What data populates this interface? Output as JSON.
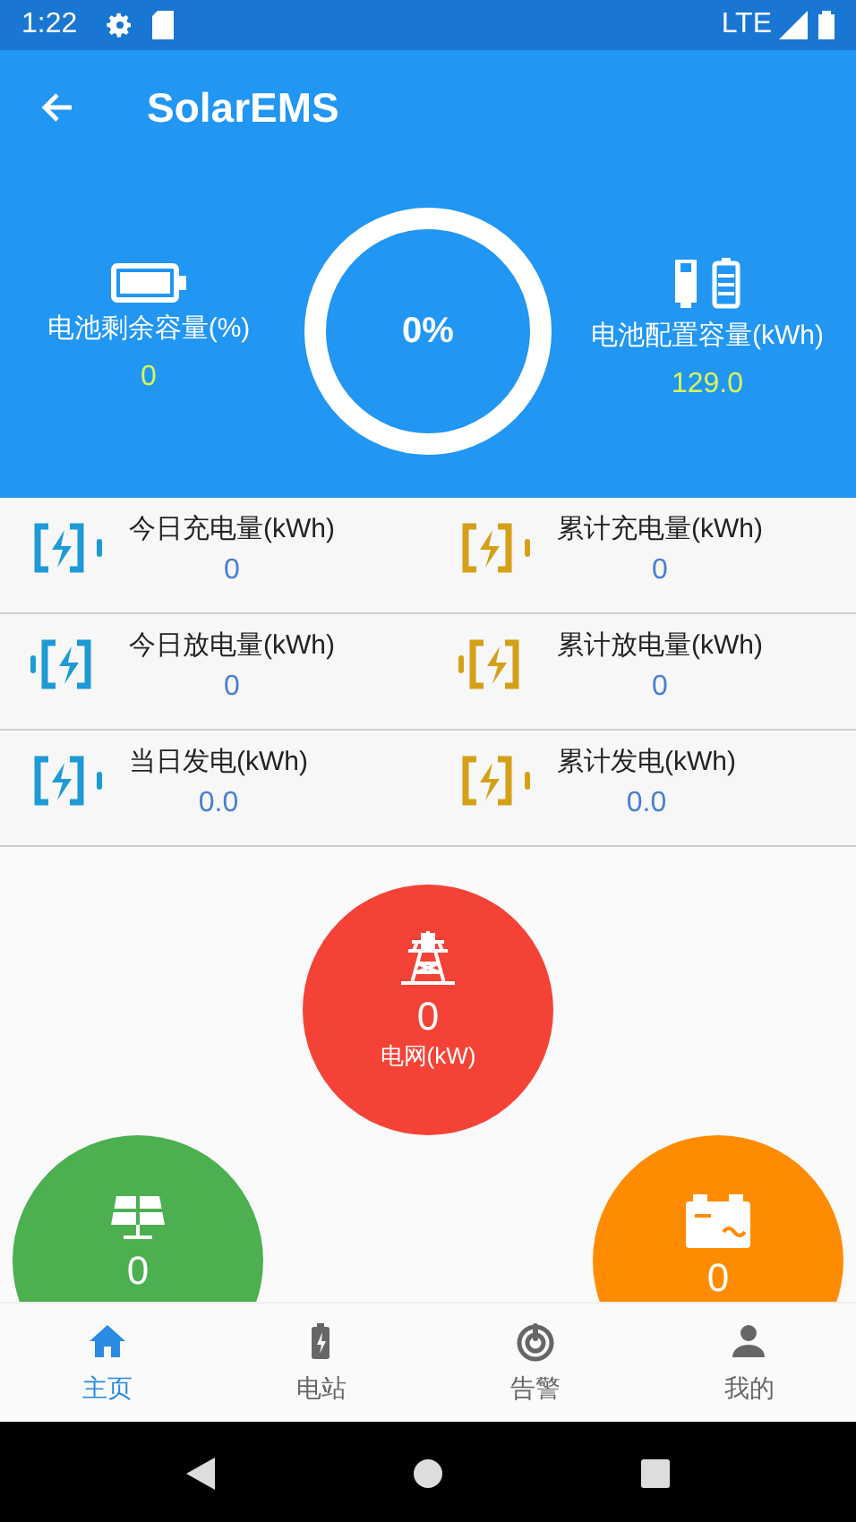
{
  "status_bar": {
    "time": "1:22",
    "network": "LTE"
  },
  "app_bar": {
    "title": "SolarEMS"
  },
  "header": {
    "left": {
      "label": "电池剩余容量(%)",
      "value": "0"
    },
    "gauge": {
      "text": "0%"
    },
    "right": {
      "label": "电池配置容量(kWh)",
      "value": "129.0"
    }
  },
  "stats": [
    {
      "label": "今日充电量(kWh)",
      "value": "0",
      "color": "#1e9ad6",
      "kind": "charge"
    },
    {
      "label": "累计充电量(kWh)",
      "value": "0",
      "color": "#d4a017",
      "kind": "charge"
    },
    {
      "label": "今日放电量(kWh)",
      "value": "0",
      "color": "#1e9ad6",
      "kind": "discharge"
    },
    {
      "label": "累计放电量(kWh)",
      "value": "0",
      "color": "#d4a017",
      "kind": "discharge"
    },
    {
      "label": "当日发电(kWh)",
      "value": "0.0",
      "color": "#1e9ad6",
      "kind": "charge"
    },
    {
      "label": "累计发电(kWh)",
      "value": "0.0",
      "color": "#d4a017",
      "kind": "charge"
    }
  ],
  "flow": [
    {
      "kind": "grid",
      "value": "0",
      "label": "电网(kW)",
      "color": "#f44336"
    },
    {
      "kind": "solar",
      "value": "0",
      "color": "#4caf50"
    },
    {
      "kind": "storage",
      "value": "0",
      "color": "#ff8c00"
    }
  ],
  "bottom_nav": [
    {
      "label": "主页",
      "kind": "home",
      "selected": true
    },
    {
      "label": "电站",
      "kind": "station",
      "selected": false
    },
    {
      "label": "告警",
      "kind": "alarm",
      "selected": false
    },
    {
      "label": "我的",
      "kind": "user",
      "selected": false
    }
  ]
}
